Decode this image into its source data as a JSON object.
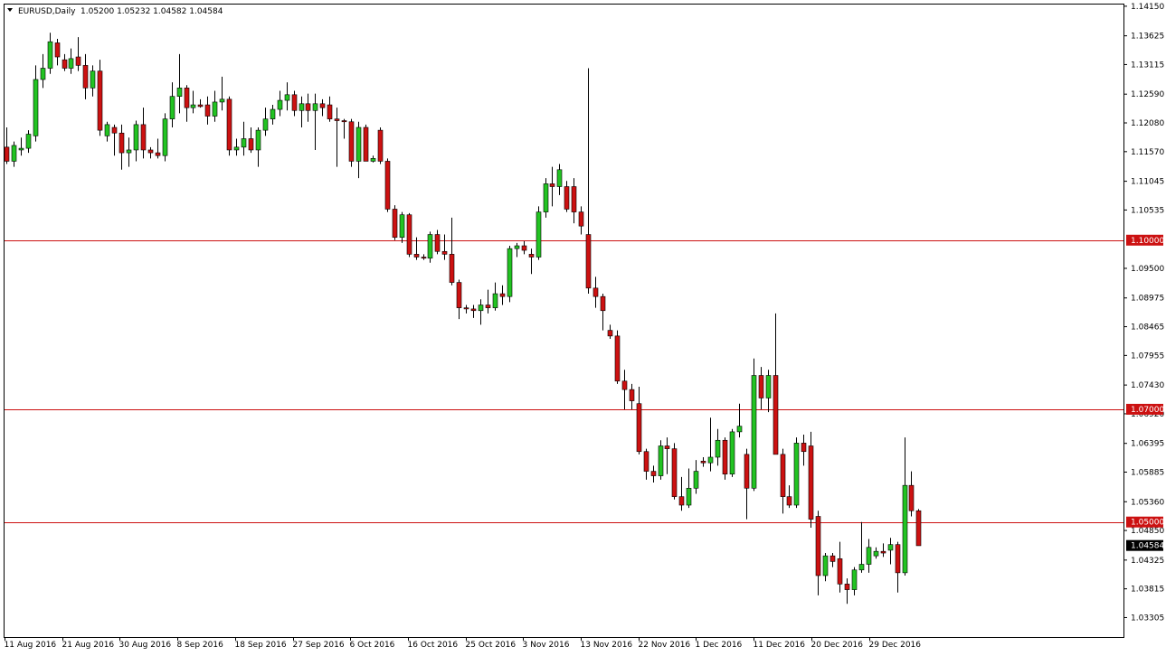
{
  "header": {
    "symbol_label": "EURUSD,Daily",
    "ohlc_label": "1.05200 1.05232 1.04582 1.04584"
  },
  "colors": {
    "bull": "#22c322",
    "bear": "#cc1111",
    "wick": "#000000",
    "grid": "#000000",
    "level_line": "#cc1111",
    "current_tag": "#000000"
  },
  "chart_data": {
    "type": "candlestick",
    "title": "",
    "xlabel": "",
    "ylabel": "",
    "grid": false,
    "ylim": [
      1.0296,
      1.1418
    ],
    "x_tick_labels": [
      "11 Aug 2016",
      "21 Aug 2016",
      "30 Aug 2016",
      "8 Sep 2016",
      "18 Sep 2016",
      "27 Sep 2016",
      "6 Oct 2016",
      "16 Oct 2016",
      "25 Oct 2016",
      "3 Nov 2016",
      "13 Nov 2016",
      "22 Nov 2016",
      "1 Dec 2016",
      "11 Dec 2016",
      "20 Dec 2016",
      "29 Dec 2016"
    ],
    "y_tick_labels": [
      "1.14150",
      "1.13625",
      "1.13115",
      "1.12590",
      "1.12080",
      "1.11570",
      "1.11045",
      "1.10535",
      "1.09500",
      "1.08975",
      "1.08465",
      "1.07955",
      "1.07430",
      "1.06920",
      "1.06395",
      "1.05885",
      "1.05360",
      "1.04850",
      "1.04325",
      "1.03815",
      "1.03305"
    ],
    "level_labels": [
      "1.10000",
      "1.07000",
      "1.05000"
    ],
    "current_price_label": "1.04584",
    "candles": [
      {
        "o": 1.1165,
        "h": 1.12,
        "l": 1.1135,
        "c": 1.114
      },
      {
        "o": 1.114,
        "h": 1.1175,
        "l": 1.113,
        "c": 1.1168
      },
      {
        "o": 1.116,
        "h": 1.1182,
        "l": 1.115,
        "c": 1.1163
      },
      {
        "o": 1.1163,
        "h": 1.1195,
        "l": 1.1155,
        "c": 1.1188
      },
      {
        "o": 1.1185,
        "h": 1.131,
        "l": 1.1175,
        "c": 1.1285
      },
      {
        "o": 1.1285,
        "h": 1.133,
        "l": 1.127,
        "c": 1.1305
      },
      {
        "o": 1.1305,
        "h": 1.1368,
        "l": 1.1295,
        "c": 1.1352
      },
      {
        "o": 1.135,
        "h": 1.1357,
        "l": 1.131,
        "c": 1.1325
      },
      {
        "o": 1.132,
        "h": 1.133,
        "l": 1.13,
        "c": 1.1305
      },
      {
        "o": 1.1305,
        "h": 1.134,
        "l": 1.1295,
        "c": 1.1322
      },
      {
        "o": 1.1325,
        "h": 1.136,
        "l": 1.13,
        "c": 1.131
      },
      {
        "o": 1.131,
        "h": 1.133,
        "l": 1.125,
        "c": 1.127
      },
      {
        "o": 1.127,
        "h": 1.131,
        "l": 1.1255,
        "c": 1.13
      },
      {
        "o": 1.13,
        "h": 1.132,
        "l": 1.1185,
        "c": 1.1195
      },
      {
        "o": 1.1185,
        "h": 1.121,
        "l": 1.1175,
        "c": 1.1205
      },
      {
        "o": 1.12,
        "h": 1.1205,
        "l": 1.115,
        "c": 1.119
      },
      {
        "o": 1.119,
        "h": 1.1205,
        "l": 1.1125,
        "c": 1.1155
      },
      {
        "o": 1.1155,
        "h": 1.1182,
        "l": 1.113,
        "c": 1.116
      },
      {
        "o": 1.116,
        "h": 1.1212,
        "l": 1.114,
        "c": 1.1205
      },
      {
        "o": 1.1205,
        "h": 1.1235,
        "l": 1.1145,
        "c": 1.116
      },
      {
        "o": 1.116,
        "h": 1.1165,
        "l": 1.1145,
        "c": 1.1155
      },
      {
        "o": 1.1155,
        "h": 1.118,
        "l": 1.1145,
        "c": 1.115
      },
      {
        "o": 1.115,
        "h": 1.1225,
        "l": 1.114,
        "c": 1.1215
      },
      {
        "o": 1.1215,
        "h": 1.128,
        "l": 1.12,
        "c": 1.1255
      },
      {
        "o": 1.1255,
        "h": 1.133,
        "l": 1.1225,
        "c": 1.127
      },
      {
        "o": 1.127,
        "h": 1.1275,
        "l": 1.121,
        "c": 1.1235
      },
      {
        "o": 1.1235,
        "h": 1.1265,
        "l": 1.1225,
        "c": 1.124
      },
      {
        "o": 1.124,
        "h": 1.125,
        "l": 1.1235,
        "c": 1.1237
      },
      {
        "o": 1.124,
        "h": 1.1255,
        "l": 1.1205,
        "c": 1.122
      },
      {
        "o": 1.122,
        "h": 1.1265,
        "l": 1.121,
        "c": 1.1245
      },
      {
        "o": 1.1245,
        "h": 1.129,
        "l": 1.123,
        "c": 1.125
      },
      {
        "o": 1.125,
        "h": 1.1255,
        "l": 1.115,
        "c": 1.116
      },
      {
        "o": 1.116,
        "h": 1.118,
        "l": 1.115,
        "c": 1.1165
      },
      {
        "o": 1.1165,
        "h": 1.121,
        "l": 1.115,
        "c": 1.118
      },
      {
        "o": 1.118,
        "h": 1.12,
        "l": 1.1155,
        "c": 1.116
      },
      {
        "o": 1.116,
        "h": 1.12,
        "l": 1.113,
        "c": 1.1195
      },
      {
        "o": 1.1195,
        "h": 1.1235,
        "l": 1.1185,
        "c": 1.1215
      },
      {
        "o": 1.1215,
        "h": 1.124,
        "l": 1.1205,
        "c": 1.1232
      },
      {
        "o": 1.1232,
        "h": 1.1265,
        "l": 1.122,
        "c": 1.1248
      },
      {
        "o": 1.1248,
        "h": 1.128,
        "l": 1.123,
        "c": 1.1258
      },
      {
        "o": 1.1258,
        "h": 1.1265,
        "l": 1.122,
        "c": 1.123
      },
      {
        "o": 1.123,
        "h": 1.1255,
        "l": 1.12,
        "c": 1.1242
      },
      {
        "o": 1.1242,
        "h": 1.126,
        "l": 1.121,
        "c": 1.123
      },
      {
        "o": 1.123,
        "h": 1.126,
        "l": 1.116,
        "c": 1.1242
      },
      {
        "o": 1.1242,
        "h": 1.125,
        "l": 1.122,
        "c": 1.1235
      },
      {
        "o": 1.124,
        "h": 1.1255,
        "l": 1.121,
        "c": 1.1215
      },
      {
        "o": 1.1215,
        "h": 1.1235,
        "l": 1.113,
        "c": 1.1212
      },
      {
        "o": 1.1212,
        "h": 1.1215,
        "l": 1.118,
        "c": 1.121
      },
      {
        "o": 1.121,
        "h": 1.1215,
        "l": 1.113,
        "c": 1.114
      },
      {
        "o": 1.114,
        "h": 1.121,
        "l": 1.111,
        "c": 1.12
      },
      {
        "o": 1.12,
        "h": 1.1205,
        "l": 1.116,
        "c": 1.114
      },
      {
        "o": 1.114,
        "h": 1.115,
        "l": 1.1138,
        "c": 1.1145
      },
      {
        "o": 1.1195,
        "h": 1.12,
        "l": 1.1135,
        "c": 1.114
      },
      {
        "o": 1.114,
        "h": 1.1145,
        "l": 1.105,
        "c": 1.1055
      },
      {
        "o": 1.1055,
        "h": 1.1062,
        "l": 1.1,
        "c": 1.1005
      },
      {
        "o": 1.1005,
        "h": 1.105,
        "l": 1.0995,
        "c": 1.1045
      },
      {
        "o": 1.1045,
        "h": 1.1048,
        "l": 1.097,
        "c": 1.0975
      },
      {
        "o": 1.0975,
        "h": 1.1005,
        "l": 1.0965,
        "c": 1.097
      },
      {
        "o": 1.097,
        "h": 1.0975,
        "l": 1.0965,
        "c": 1.0968
      },
      {
        "o": 1.0968,
        "h": 1.1015,
        "l": 1.096,
        "c": 1.101
      },
      {
        "o": 1.101,
        "h": 1.1018,
        "l": 1.0975,
        "c": 1.098
      },
      {
        "o": 1.098,
        "h": 1.101,
        "l": 1.0965,
        "c": 1.0975
      },
      {
        "o": 1.0975,
        "h": 1.104,
        "l": 1.092,
        "c": 1.0925
      },
      {
        "o": 1.0925,
        "h": 1.093,
        "l": 1.086,
        "c": 1.088
      },
      {
        "o": 1.088,
        "h": 1.0885,
        "l": 1.087,
        "c": 1.0878
      },
      {
        "o": 1.0878,
        "h": 1.0885,
        "l": 1.0862,
        "c": 1.0875
      },
      {
        "o": 1.0875,
        "h": 1.0895,
        "l": 1.085,
        "c": 1.0885
      },
      {
        "o": 1.0885,
        "h": 1.0912,
        "l": 1.087,
        "c": 1.088
      },
      {
        "o": 1.088,
        "h": 1.0925,
        "l": 1.0875,
        "c": 1.0905
      },
      {
        "o": 1.0905,
        "h": 1.092,
        "l": 1.0885,
        "c": 1.09
      },
      {
        "o": 1.09,
        "h": 1.099,
        "l": 1.089,
        "c": 1.0985
      },
      {
        "o": 1.0985,
        "h": 1.0995,
        "l": 1.097,
        "c": 1.099
      },
      {
        "o": 1.099,
        "h": 1.0998,
        "l": 1.0975,
        "c": 1.0982
      },
      {
        "o": 1.0975,
        "h": 1.0985,
        "l": 1.094,
        "c": 1.097
      },
      {
        "o": 1.097,
        "h": 1.106,
        "l": 1.0965,
        "c": 1.105
      },
      {
        "o": 1.105,
        "h": 1.111,
        "l": 1.104,
        "c": 1.11
      },
      {
        "o": 1.11,
        "h": 1.113,
        "l": 1.106,
        "c": 1.1095
      },
      {
        "o": 1.1095,
        "h": 1.1135,
        "l": 1.108,
        "c": 1.1125
      },
      {
        "o": 1.1095,
        "h": 1.1105,
        "l": 1.105,
        "c": 1.1055
      },
      {
        "o": 1.1095,
        "h": 1.111,
        "l": 1.103,
        "c": 1.105
      },
      {
        "o": 1.105,
        "h": 1.106,
        "l": 1.101,
        "c": 1.1025
      },
      {
        "o": 1.101,
        "h": 1.1305,
        "l": 1.0905,
        "c": 1.0915
      },
      {
        "o": 1.0915,
        "h": 1.0935,
        "l": 1.088,
        "c": 1.09
      },
      {
        "o": 1.09,
        "h": 1.0905,
        "l": 1.084,
        "c": 1.0875
      },
      {
        "o": 1.084,
        "h": 1.085,
        "l": 1.0825,
        "c": 1.083
      },
      {
        "o": 1.083,
        "h": 1.084,
        "l": 1.0745,
        "c": 1.075
      },
      {
        "o": 1.075,
        "h": 1.077,
        "l": 1.07,
        "c": 1.0735
      },
      {
        "o": 1.0735,
        "h": 1.0745,
        "l": 1.07,
        "c": 1.0715
      },
      {
        "o": 1.071,
        "h": 1.074,
        "l": 1.062,
        "c": 1.0625
      },
      {
        "o": 1.0625,
        "h": 1.063,
        "l": 1.0575,
        "c": 1.059
      },
      {
        "o": 1.059,
        "h": 1.06,
        "l": 1.057,
        "c": 1.0582
      },
      {
        "o": 1.0582,
        "h": 1.0645,
        "l": 1.0575,
        "c": 1.0635
      },
      {
        "o": 1.0635,
        "h": 1.065,
        "l": 1.0585,
        "c": 1.063
      },
      {
        "o": 1.063,
        "h": 1.064,
        "l": 1.054,
        "c": 1.0545
      },
      {
        "o": 1.0545,
        "h": 1.058,
        "l": 1.052,
        "c": 1.053
      },
      {
        "o": 1.053,
        "h": 1.0595,
        "l": 1.0525,
        "c": 1.056
      },
      {
        "o": 1.056,
        "h": 1.061,
        "l": 1.055,
        "c": 1.059
      },
      {
        "o": 1.0608,
        "h": 1.0615,
        "l": 1.0598,
        "c": 1.0605
      },
      {
        "o": 1.0605,
        "h": 1.0685,
        "l": 1.059,
        "c": 1.0615
      },
      {
        "o": 1.0615,
        "h": 1.0665,
        "l": 1.06,
        "c": 1.0645
      },
      {
        "o": 1.0645,
        "h": 1.065,
        "l": 1.0575,
        "c": 1.0585
      },
      {
        "o": 1.0585,
        "h": 1.0665,
        "l": 1.058,
        "c": 1.066
      },
      {
        "o": 1.066,
        "h": 1.071,
        "l": 1.065,
        "c": 1.067
      },
      {
        "o": 1.062,
        "h": 1.063,
        "l": 1.0505,
        "c": 1.056
      },
      {
        "o": 1.056,
        "h": 1.079,
        "l": 1.0555,
        "c": 1.076
      },
      {
        "o": 1.076,
        "h": 1.0775,
        "l": 1.07,
        "c": 1.072
      },
      {
        "o": 1.072,
        "h": 1.077,
        "l": 1.0695,
        "c": 1.076
      },
      {
        "o": 1.076,
        "h": 1.087,
        "l": 1.07,
        "c": 1.062
      },
      {
        "o": 1.062,
        "h": 1.063,
        "l": 1.0515,
        "c": 1.0545
      },
      {
        "o": 1.0545,
        "h": 1.0565,
        "l": 1.0525,
        "c": 1.053
      },
      {
        "o": 1.053,
        "h": 1.065,
        "l": 1.0525,
        "c": 1.064
      },
      {
        "o": 1.064,
        "h": 1.0655,
        "l": 1.06,
        "c": 1.0625
      },
      {
        "o": 1.0635,
        "h": 1.066,
        "l": 1.049,
        "c": 1.0505
      },
      {
        "o": 1.051,
        "h": 1.052,
        "l": 1.037,
        "c": 1.0405
      },
      {
        "o": 1.0405,
        "h": 1.0445,
        "l": 1.0395,
        "c": 1.044
      },
      {
        "o": 1.044,
        "h": 1.0445,
        "l": 1.042,
        "c": 1.043
      },
      {
        "o": 1.0435,
        "h": 1.0465,
        "l": 1.0375,
        "c": 1.039
      },
      {
        "o": 1.039,
        "h": 1.04,
        "l": 1.0355,
        "c": 1.038
      },
      {
        "o": 1.038,
        "h": 1.042,
        "l": 1.037,
        "c": 1.0415
      },
      {
        "o": 1.0415,
        "h": 1.05,
        "l": 1.041,
        "c": 1.0425
      },
      {
        "o": 1.0425,
        "h": 1.047,
        "l": 1.041,
        "c": 1.0455
      },
      {
        "o": 1.044,
        "h": 1.0455,
        "l": 1.0435,
        "c": 1.0448
      },
      {
        "o": 1.0448,
        "h": 1.0462,
        "l": 1.0438,
        "c": 1.0445
      },
      {
        "o": 1.045,
        "h": 1.0472,
        "l": 1.0425,
        "c": 1.046
      },
      {
        "o": 1.046,
        "h": 1.0465,
        "l": 1.0375,
        "c": 1.041
      },
      {
        "o": 1.041,
        "h": 1.065,
        "l": 1.0405,
        "c": 1.0565
      },
      {
        "o": 1.0565,
        "h": 1.059,
        "l": 1.051,
        "c": 1.052
      },
      {
        "o": 1.052,
        "h": 1.0523,
        "l": 1.0458,
        "c": 1.0458
      }
    ]
  }
}
